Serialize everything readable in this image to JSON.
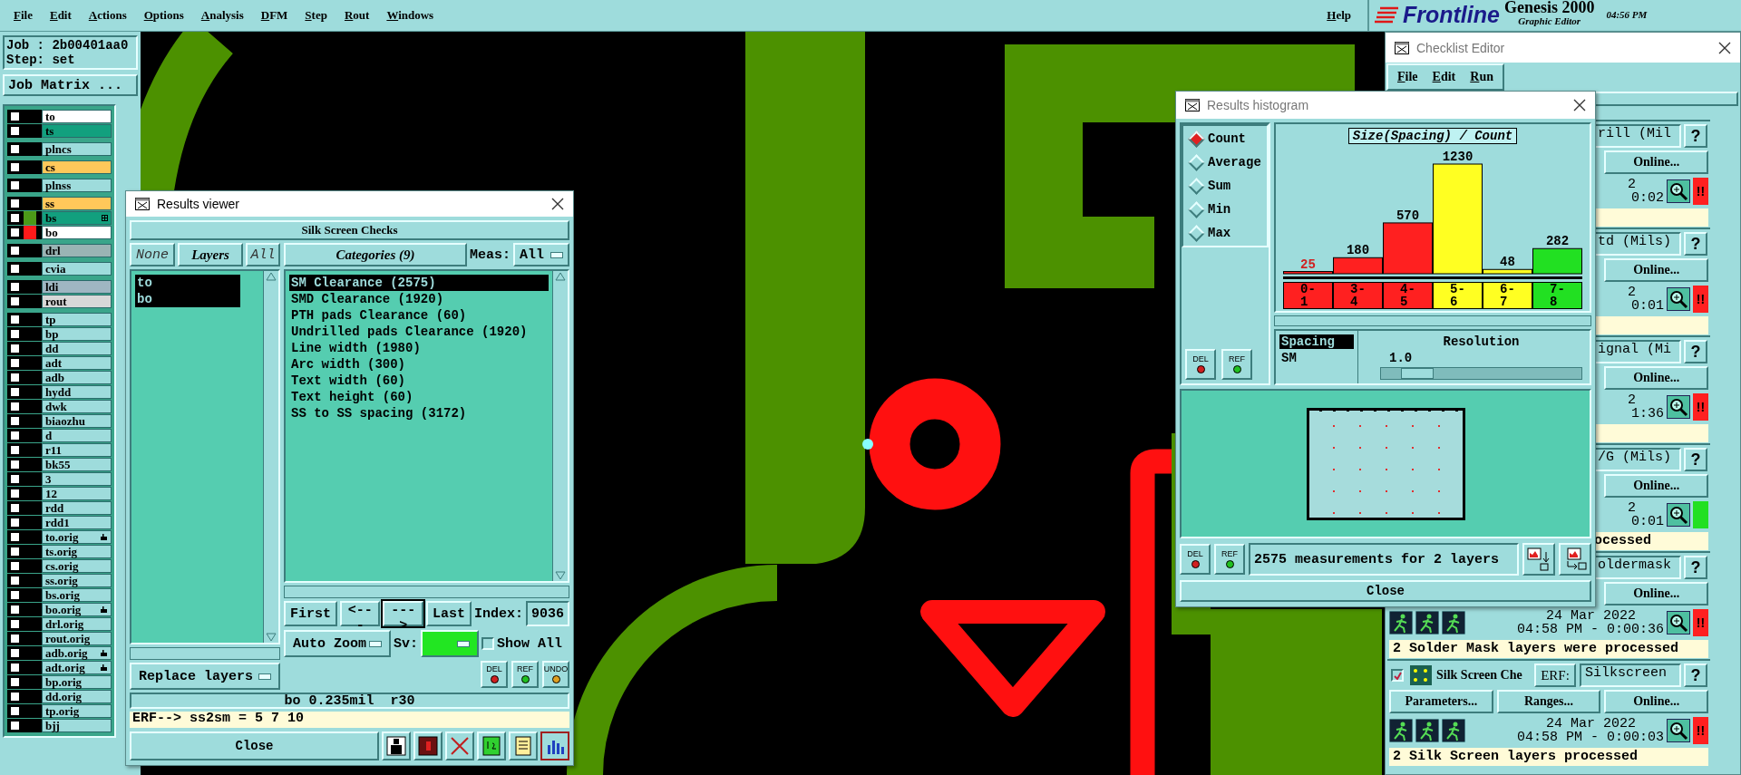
{
  "menu_bar": {
    "items": [
      "File",
      "Edit",
      "Actions",
      "Options",
      "Analysis",
      "DFM",
      "Step",
      "Rout",
      "Windows"
    ],
    "help": "Help"
  },
  "brand": {
    "logo": "Frontline",
    "product": "Genesis 2000",
    "subtitle": "Graphic Editor",
    "time": "04:56 PM"
  },
  "job_panel": {
    "job": "Job : 2b00401aa0",
    "step": "Step: set",
    "matrix_button": "Job Matrix ...",
    "layer_groups": [
      [
        {
          "name": "to",
          "color": "#ffffff",
          "checked": false,
          "kind": "plain"
        },
        {
          "name": "ts",
          "color": "#12a07e",
          "checked": false,
          "kind": "plain"
        }
      ],
      [
        {
          "name": "plncs",
          "color": "#9edcdc",
          "checked": false,
          "kind": "plain"
        }
      ],
      [
        {
          "name": "cs",
          "color": "#ffc85a",
          "checked": false,
          "kind": "plain"
        }
      ],
      [
        {
          "name": "plnss",
          "color": "#9edcdc",
          "checked": false,
          "kind": "plain"
        }
      ],
      [
        {
          "name": "ss",
          "color": "#ffc85a",
          "checked": false,
          "kind": "plain"
        },
        {
          "name": "bs",
          "color": "#12a07e",
          "swatch": {
            "color": "#4c9a18"
          },
          "checked": false,
          "kind": "grouped"
        },
        {
          "name": "bo",
          "color": "#ffffff",
          "swatch": {
            "color": "#ff1a1a"
          },
          "checked": false,
          "kind": "plain"
        }
      ],
      [
        {
          "name": "drl",
          "color": "#9ab4b4",
          "checked": false,
          "kind": "plain"
        }
      ],
      [
        {
          "name": "cvia",
          "color": "#9edcdc",
          "checked": false,
          "kind": "plain"
        }
      ],
      [
        {
          "name": "ldi",
          "color": "#9fb6c2",
          "checked": false,
          "kind": "plain"
        },
        {
          "name": "rout",
          "color": "#d8d8d8",
          "checked": false,
          "kind": "plain"
        }
      ],
      [
        {
          "name": "tp",
          "color": "#9edcdc",
          "checked": false,
          "kind": "plain"
        },
        {
          "name": "bp",
          "color": "#9edcdc",
          "checked": false,
          "kind": "plain"
        },
        {
          "name": "dd",
          "color": "#9edcdc",
          "checked": false,
          "kind": "plain"
        },
        {
          "name": "adt",
          "color": "#9edcdc",
          "checked": false,
          "kind": "plain"
        },
        {
          "name": "adb",
          "color": "#9edcdc",
          "checked": false,
          "kind": "plain"
        },
        {
          "name": "hydd",
          "color": "#9edcdc",
          "checked": false,
          "kind": "plain"
        },
        {
          "name": "dwk",
          "color": "#9edcdc",
          "checked": false,
          "kind": "plain"
        },
        {
          "name": "biaozhu",
          "color": "#9edcdc",
          "checked": false,
          "kind": "plain"
        },
        {
          "name": "d",
          "color": "#9edcdc",
          "checked": false,
          "kind": "plain"
        },
        {
          "name": "r11",
          "color": "#9edcdc",
          "checked": false,
          "kind": "plain"
        },
        {
          "name": "bk55",
          "color": "#9edcdc",
          "checked": false,
          "kind": "plain"
        },
        {
          "name": "3",
          "color": "#9edcdc",
          "checked": false,
          "kind": "plain"
        },
        {
          "name": "12",
          "color": "#9edcdc",
          "checked": false,
          "kind": "plain"
        },
        {
          "name": "rdd",
          "color": "#9edcdc",
          "checked": false,
          "kind": "plain"
        },
        {
          "name": "rdd1",
          "color": "#9edcdc",
          "checked": false,
          "kind": "plain"
        },
        {
          "name": "to.orig",
          "color": "#9edcdc",
          "checked": false,
          "kind": "modified"
        },
        {
          "name": "ts.orig",
          "color": "#9edcdc",
          "checked": false,
          "kind": "plain"
        },
        {
          "name": "cs.orig",
          "color": "#9edcdc",
          "checked": false,
          "kind": "plain"
        },
        {
          "name": "ss.orig",
          "color": "#9edcdc",
          "checked": false,
          "kind": "plain"
        },
        {
          "name": "bs.orig",
          "color": "#9edcdc",
          "checked": false,
          "kind": "plain"
        },
        {
          "name": "bo.orig",
          "color": "#9edcdc",
          "checked": false,
          "kind": "modified"
        },
        {
          "name": "drl.orig",
          "color": "#9edcdc",
          "checked": false,
          "kind": "plain"
        },
        {
          "name": "rout.orig",
          "color": "#9edcdc",
          "checked": false,
          "kind": "plain"
        },
        {
          "name": "adb.orig",
          "color": "#9edcdc",
          "checked": false,
          "kind": "modified"
        },
        {
          "name": "adt.orig",
          "color": "#9edcdc",
          "checked": false,
          "kind": "modified"
        },
        {
          "name": "bp.orig",
          "color": "#9edcdc",
          "checked": false,
          "kind": "plain"
        },
        {
          "name": "dd.orig",
          "color": "#9edcdc",
          "checked": false,
          "kind": "plain"
        },
        {
          "name": "tp.orig",
          "color": "#9edcdc",
          "checked": false,
          "kind": "plain"
        },
        {
          "name": "bjj",
          "color": "#9edcdc",
          "checked": false,
          "kind": "plain"
        }
      ]
    ]
  },
  "results_viewer": {
    "title": "Results viewer",
    "heading": "Silk Screen Checks",
    "none_button": "None",
    "layers_label": "Layers",
    "all_button": "All",
    "layers": [
      {
        "name": "to",
        "selected": true
      },
      {
        "name": "bo",
        "selected": true
      }
    ],
    "replace_dropdown": "Replace layers",
    "categories_label": "Categories (9)",
    "meas_label": "Meas:",
    "meas_value": "All",
    "categories": [
      {
        "label": "SM Clearance (2575)",
        "selected": true
      },
      {
        "label": "SMD Clearance (1920)",
        "selected": false
      },
      {
        "label": "PTH pads Clearance (60)",
        "selected": false
      },
      {
        "label": "Undrilled pads Clearance (1920)",
        "selected": false
      },
      {
        "label": "Line width (1980)",
        "selected": false
      },
      {
        "label": "Arc width (300)",
        "selected": false
      },
      {
        "label": "Text width (60)",
        "selected": false
      },
      {
        "label": "Text height (60)",
        "selected": false
      },
      {
        "label": "SS to SS spacing (3172)",
        "selected": false
      }
    ],
    "nav": {
      "first": "First",
      "prev": "<---",
      "next": "--->",
      "last": "Last",
      "index_label": "Index:",
      "index_value": "9036"
    },
    "zoom_dropdown": "Auto Zoom",
    "sv": {
      "label": "Sv:",
      "color": "#22e622"
    },
    "show_all": {
      "label": "Show All",
      "checked": false
    },
    "tool_buttons": [
      "DEL",
      "REF",
      "UNDO"
    ],
    "status": "bo 0.235mil  r30",
    "erf_line": "ERF--> ss2sm = 5 7 10",
    "close": "Close"
  },
  "histogram": {
    "title": "Results histogram",
    "modes": [
      {
        "label": "Count",
        "selected": true
      },
      {
        "label": "Average",
        "selected": false
      },
      {
        "label": "Sum",
        "selected": false
      },
      {
        "label": "Min",
        "selected": false
      },
      {
        "label": "Max",
        "selected": false
      }
    ],
    "side_buttons": [
      "DEL",
      "REF"
    ],
    "chart_data": {
      "type": "bar",
      "title": "Size(Spacing) / Count",
      "categories": [
        "0-1",
        "3-4",
        "4-5",
        "5-6",
        "6-7",
        "7-8"
      ],
      "series": [
        {
          "color": "#ff2020",
          "values": [
            25,
            180,
            570,
            null,
            null,
            null
          ]
        },
        {
          "color": "#ffff22",
          "values": [
            null,
            null,
            null,
            1230,
            48,
            null
          ]
        },
        {
          "color": "#22e022",
          "values": [
            null,
            null,
            null,
            null,
            null,
            282
          ]
        }
      ],
      "stacked": true,
      "data_labels": true
    },
    "measure_list": [
      {
        "label": "Spacing",
        "selected": true
      },
      {
        "label": "SM",
        "selected": false
      }
    ],
    "resolution": {
      "label": "Resolution",
      "value": "1.0",
      "level": 0.1
    },
    "bottom_buttons": [
      "DEL",
      "REF"
    ],
    "summary": "2575 measurements for 2 layers",
    "close": "Close"
  },
  "checklist": {
    "title": "Checklist Editor",
    "menu": [
      "File",
      "Edit",
      "Run"
    ],
    "rows": [
      {
        "kind": "clipped",
        "erf_value": "rill (Mil",
        "help": "?",
        "buttons": [
          "Online..."
        ],
        "date": "2",
        "time": "0:02",
        "flag": "!!",
        "color": "#ff2020"
      },
      {
        "kind": "clipped",
        "erf_value": "td (Mils)",
        "help": "?",
        "buttons": [
          "Online..."
        ],
        "date": "2",
        "time": "0:01",
        "flag": "!!",
        "color": "#ff2020"
      },
      {
        "kind": "clipped",
        "erf_value": "ignal (Mi",
        "help": "?",
        "buttons": [
          "Online..."
        ],
        "date": "2",
        "time": "1:36",
        "flag": "!!",
        "color": "#ff2020"
      },
      {
        "kind": "clipped",
        "erf_value": "/G (Mils)",
        "help": "?",
        "buttons": [
          "Online..."
        ],
        "date": "2",
        "time": "0:01",
        "color": "#22e022",
        "message": "ocessed"
      },
      {
        "kind": "partial",
        "erf_value": "oldermask",
        "help": "?",
        "buttons": [
          "Online..."
        ],
        "date": "24 Mar 2022",
        "time": "04:58 PM - 0:00:36",
        "flag": "!!",
        "color": "#ff2020",
        "message": "2 Solder Mask layers were processed"
      },
      {
        "kind": "full",
        "checked": true,
        "name": "Silk Screen Che",
        "erf_label": "ERF:",
        "erf_value": "Silkscreen",
        "help": "?",
        "buttons": [
          "Parameters...",
          "Ranges...",
          "Online..."
        ],
        "date": "24 Mar 2022",
        "time": "04:58 PM - 0:00:03",
        "flag": "!!",
        "color": "#ff2020",
        "message": "2 Silk Screen layers processed"
      }
    ]
  }
}
